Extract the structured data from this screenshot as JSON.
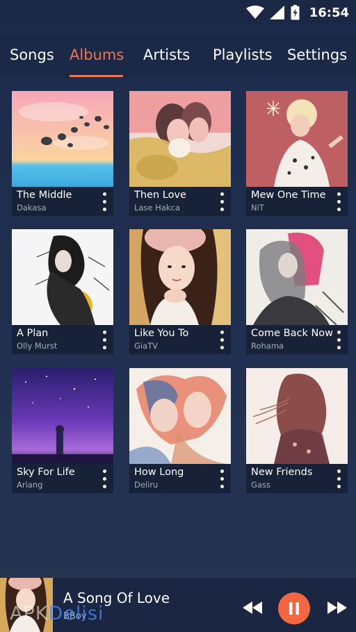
{
  "status_bar": {
    "time": "16:54",
    "icons": [
      "wifi-icon",
      "cell-signal-icon",
      "battery-charging-icon"
    ]
  },
  "tabs": [
    {
      "label": "Songs",
      "active": false
    },
    {
      "label": "Albums",
      "active": true
    },
    {
      "label": "Artists",
      "active": false
    },
    {
      "label": "Playlists",
      "active": false
    },
    {
      "label": "Settings",
      "active": false
    }
  ],
  "albums": [
    {
      "title": "The Middle",
      "artist": "Dakasa"
    },
    {
      "title": "Then Love",
      "artist": "Lase Hakca"
    },
    {
      "title": "Mew One Time",
      "artist": "NiT"
    },
    {
      "title": "A Plan",
      "artist": "Olly Murst"
    },
    {
      "title": "Like You To",
      "artist": "GiaTV"
    },
    {
      "title": "Come Back Now",
      "artist": "Rohama"
    },
    {
      "title": "Sky For Life",
      "artist": "Ariang"
    },
    {
      "title": "How Long",
      "artist": "Deliru"
    },
    {
      "title": "New Friends",
      "artist": "Gass"
    }
  ],
  "now_playing": {
    "title": "A Song Of Love",
    "artist": "BBoy"
  },
  "watermark": {
    "part1": "APK",
    "part2": "Delisi"
  },
  "colors": {
    "accent": "#f2734f",
    "background": "#1f2d4f"
  }
}
